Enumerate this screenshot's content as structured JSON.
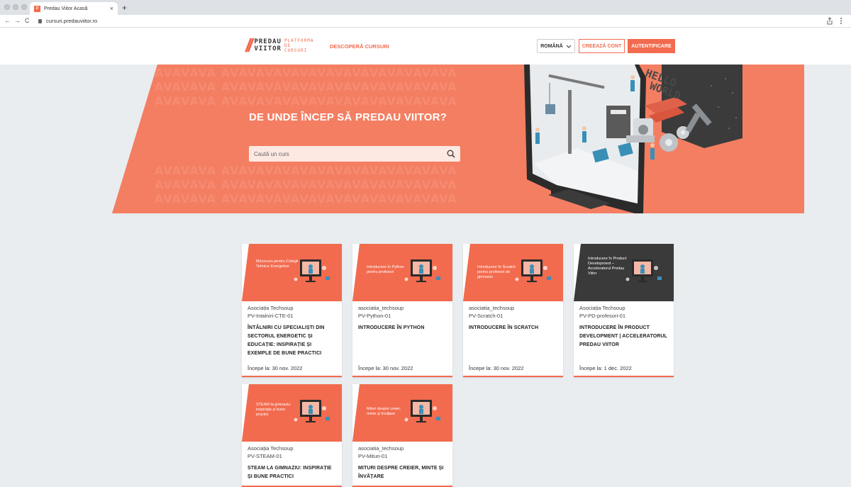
{
  "browser": {
    "tab_title": "Predau Viitor Acasă",
    "tab_favicon_text": "//",
    "tab_close": "×",
    "new_tab": "+",
    "url": "cursuri.predauviitor.ro",
    "back": "←",
    "forward": "→",
    "reload": "C",
    "share_icon": "share-icon",
    "menu_icon": "more-vert-icon"
  },
  "header": {
    "logo_slashes": "//",
    "logo_line1": "PREDAU",
    "logo_line2": "VIITOR",
    "logo_tag1": "PLATFORMA",
    "logo_tag2": "DE",
    "logo_tag3": "CURSURI",
    "nav_discover": "DESCOPERĂ CURSURI",
    "language": "ROMÂNĂ",
    "create_account": "CREEAZĂ CONT",
    "login": "AUTENTIFICARE"
  },
  "hero": {
    "title": "DE UNDE ÎNCEP SĂ PREDAU VIITOR?",
    "search_placeholder": "Caută un curs",
    "pattern": "AVAVAVA AVAVAVAVAVAVAVAVAVAVAVAVAVA",
    "illustration_text1": "HELLO",
    "illustration_text2": "WORLD"
  },
  "courses": [
    {
      "image_text": "Microcurs pentru Colegii Tehnice Energetice",
      "org": "Asociația Techsoup",
      "code": "PV-Intalniri-CTE-01",
      "title": "ÎNTÂLNIRI CU SPECIALIȘTI DIN SECTORUL ENERGETIC ȘI EDUCAȚIE: INSPIRAȚIE ȘI EXEMPLE DE BUNE PRACTICI PENTRU PROFESORI DIN",
      "start": "Începe la: 30 nov. 2022"
    },
    {
      "image_text": "Introducere în Python pentru profesori",
      "org": "asociatia_techsoup",
      "code": "PV-Python-01",
      "title": "INTRODUCERE ÎN PYTHON",
      "start": "Începe la: 30 nov. 2022"
    },
    {
      "image_text": "Introducere în Scratch pentru profesori de gimnaziu",
      "org": "asociatia_techsoup",
      "code": "PV-Scratch-01",
      "title": "INTRODUCERE ÎN SCRATCH",
      "start": "Începe la: 30 nov. 2022"
    },
    {
      "image_text": "Introducere în Product Development – Acceleratorul Predau Viitor",
      "org": "Asociația Techsoup",
      "code": "PV-PD-profesori-01",
      "title": "INTRODUCERE ÎN PRODUCT DEVELOPMENT | ACCELERATORUL PREDAU VIITOR",
      "start": "Începe la: 1 dec. 2022"
    },
    {
      "image_text": "STEAM la gimnaziu: inspirație și bune practici",
      "org": "Asociația Techsoup",
      "code": "PV-STEAM-01",
      "title": "STEAM LA GIMNAZIU: INSPIRAȚIE ȘI BUNE PRACTICI",
      "start": ""
    },
    {
      "image_text": "Mituri despre creier, minte și învățare",
      "org": "asociatia_techsoup",
      "code": "PV-Mituri-01",
      "title": "MITURI DESPRE CREIER, MINTE ȘI ÎNVĂȚARE",
      "start": ""
    }
  ],
  "colors": {
    "brand": "#f26b4e",
    "hero": "#f47e62",
    "dark_card": "#3a3a3a",
    "page_bg": "#e9edf0"
  }
}
